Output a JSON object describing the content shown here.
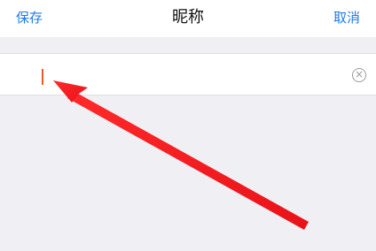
{
  "navigation": {
    "title": "昵称",
    "left_label": "保存",
    "right_label": "取消"
  },
  "form": {
    "nickname_value": "",
    "nickname_placeholder": "",
    "clear_symbol": "×"
  },
  "annotation": {
    "arrow_color": "#ee1f23"
  },
  "colors": {
    "accent": "#1f7ae8",
    "background": "#efeff4",
    "cursor": "#f05a24"
  }
}
